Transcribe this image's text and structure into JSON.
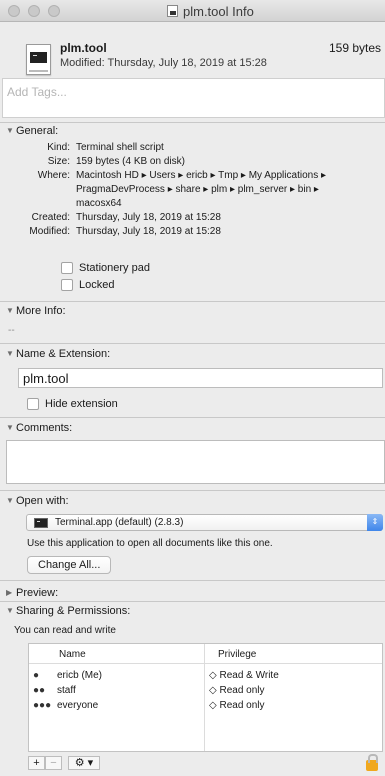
{
  "window": {
    "title": "plm.tool Info"
  },
  "header": {
    "file_name": "plm.tool",
    "file_size": "159 bytes",
    "modified": "Modified: Thursday, July 18, 2019 at 15:28"
  },
  "tags": {
    "placeholder": "Add Tags..."
  },
  "general": {
    "label": "General:",
    "kind_key": "Kind:",
    "kind_val": "Terminal shell script",
    "size_key": "Size:",
    "size_val": "159 bytes (4 KB on disk)",
    "where_key": "Where:",
    "where_line1": "Macintosh HD ▸ Users ▸ ericb ▸ Tmp ▸ My Applications ▸",
    "where_line2": "PragmaDevProcess ▸ share ▸ plm ▸ plm_server ▸ bin ▸",
    "where_line3": "macosx64",
    "created_key": "Created:",
    "created_val": "Thursday, July 18, 2019 at 15:28",
    "modified_key": "Modified:",
    "modified_val": "Thursday, July 18, 2019 at 15:28",
    "stationery_label": "Stationery pad",
    "locked_label": "Locked"
  },
  "more_info": {
    "label": "More Info:",
    "value": "--"
  },
  "name_ext": {
    "label": "Name & Extension:",
    "name_value": "plm.tool",
    "hide_ext_label": "Hide extension"
  },
  "comments": {
    "label": "Comments:"
  },
  "open_with": {
    "label": "Open with:",
    "app": "Terminal.app (default) (2.8.3)",
    "hint": "Use this application to open all documents like this one.",
    "change_all": "Change All..."
  },
  "preview": {
    "label": "Preview:"
  },
  "sharing": {
    "label": "Sharing & Permissions:",
    "status": "You can read and write",
    "col_name": "Name",
    "col_priv": "Privilege",
    "rows": [
      {
        "name": "ericb (Me)",
        "priv": "◇ Read & Write",
        "icon": "user-icon"
      },
      {
        "name": "staff",
        "priv": "◇ Read only",
        "icon": "group-icon"
      },
      {
        "name": "everyone",
        "priv": "◇ Read only",
        "icon": "everyone-icon"
      }
    ]
  },
  "toolbar": {
    "add": "+",
    "remove": "−",
    "gear": "⚙︎ ▾"
  },
  "colors": {
    "accent": "#3f85ea",
    "lock": "#f0a81e"
  }
}
